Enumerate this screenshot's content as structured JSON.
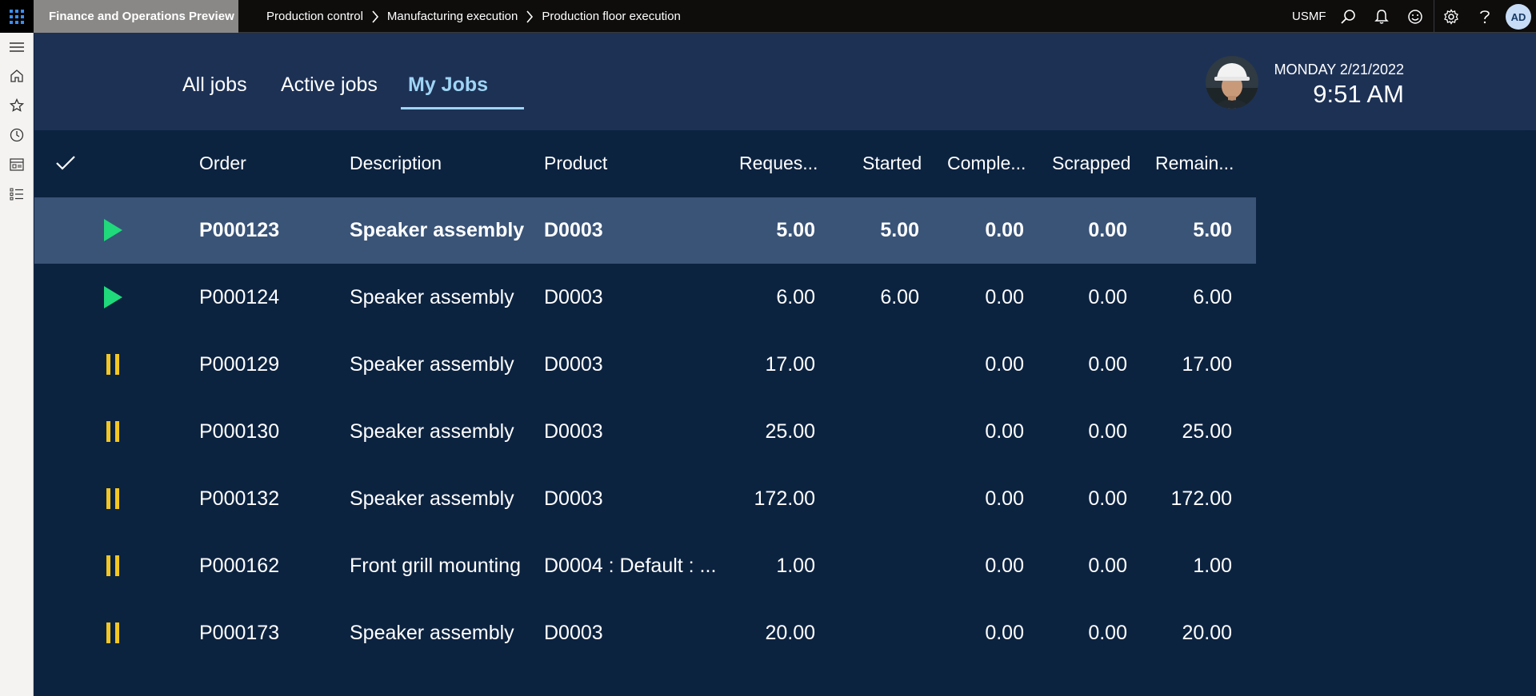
{
  "topbar": {
    "app_title": "Finance and Operations Preview",
    "breadcrumb": [
      "Production control",
      "Manufacturing execution",
      "Production floor execution"
    ],
    "company": "USMF",
    "user_initials": "AD"
  },
  "tabs": [
    {
      "label": "All jobs",
      "active": false
    },
    {
      "label": "Active jobs",
      "active": false
    },
    {
      "label": "My Jobs",
      "active": true
    }
  ],
  "datetime": {
    "date": "MONDAY 2/21/2022",
    "time": "9:51 AM"
  },
  "columns": [
    "Order",
    "Description",
    "Product",
    "Reques...",
    "Started",
    "Comple...",
    "Scrapped",
    "Remain..."
  ],
  "rows": [
    {
      "status": "play",
      "order": "P000123",
      "description": "Speaker assembly",
      "product": "D0003",
      "requested": "5.00",
      "started": "5.00",
      "completed": "0.00",
      "scrapped": "0.00",
      "remaining": "5.00",
      "selected": true
    },
    {
      "status": "play",
      "order": "P000124",
      "description": "Speaker assembly",
      "product": "D0003",
      "requested": "6.00",
      "started": "6.00",
      "completed": "0.00",
      "scrapped": "0.00",
      "remaining": "6.00",
      "selected": false
    },
    {
      "status": "pause",
      "order": "P000129",
      "description": "Speaker assembly",
      "product": "D0003",
      "requested": "17.00",
      "started": "",
      "completed": "0.00",
      "scrapped": "0.00",
      "remaining": "17.00",
      "selected": false
    },
    {
      "status": "pause",
      "order": "P000130",
      "description": "Speaker assembly",
      "product": "D0003",
      "requested": "25.00",
      "started": "",
      "completed": "0.00",
      "scrapped": "0.00",
      "remaining": "25.00",
      "selected": false
    },
    {
      "status": "pause",
      "order": "P000132",
      "description": "Speaker assembly",
      "product": "D0003",
      "requested": "172.00",
      "started": "",
      "completed": "0.00",
      "scrapped": "0.00",
      "remaining": "172.00",
      "selected": false
    },
    {
      "status": "pause",
      "order": "P000162",
      "description": "Front grill mounting",
      "product": "D0004 : Default :  ...",
      "requested": "1.00",
      "started": "",
      "completed": "0.00",
      "scrapped": "0.00",
      "remaining": "1.00",
      "selected": false
    },
    {
      "status": "pause",
      "order": "P000173",
      "description": "Speaker assembly",
      "product": "D0003",
      "requested": "20.00",
      "started": "",
      "completed": "0.00",
      "scrapped": "0.00",
      "remaining": "20.00",
      "selected": false
    }
  ],
  "colors": {
    "play": "#1fd97b",
    "pause": "#f3c623",
    "accent": "#9fd5f4",
    "background": "#0c2340",
    "header_bg": "#1d3155",
    "selected_row": "#3a5478"
  },
  "icons": {
    "waffle": "app-launcher-icon",
    "search": "search-icon",
    "bell": "bell-icon",
    "smiley": "feedback-icon",
    "gear": "gear-icon",
    "help": "help-icon",
    "nav": [
      "hamburger-icon",
      "home-icon",
      "star-icon",
      "clock-icon",
      "workspace-icon",
      "list-icon"
    ]
  }
}
